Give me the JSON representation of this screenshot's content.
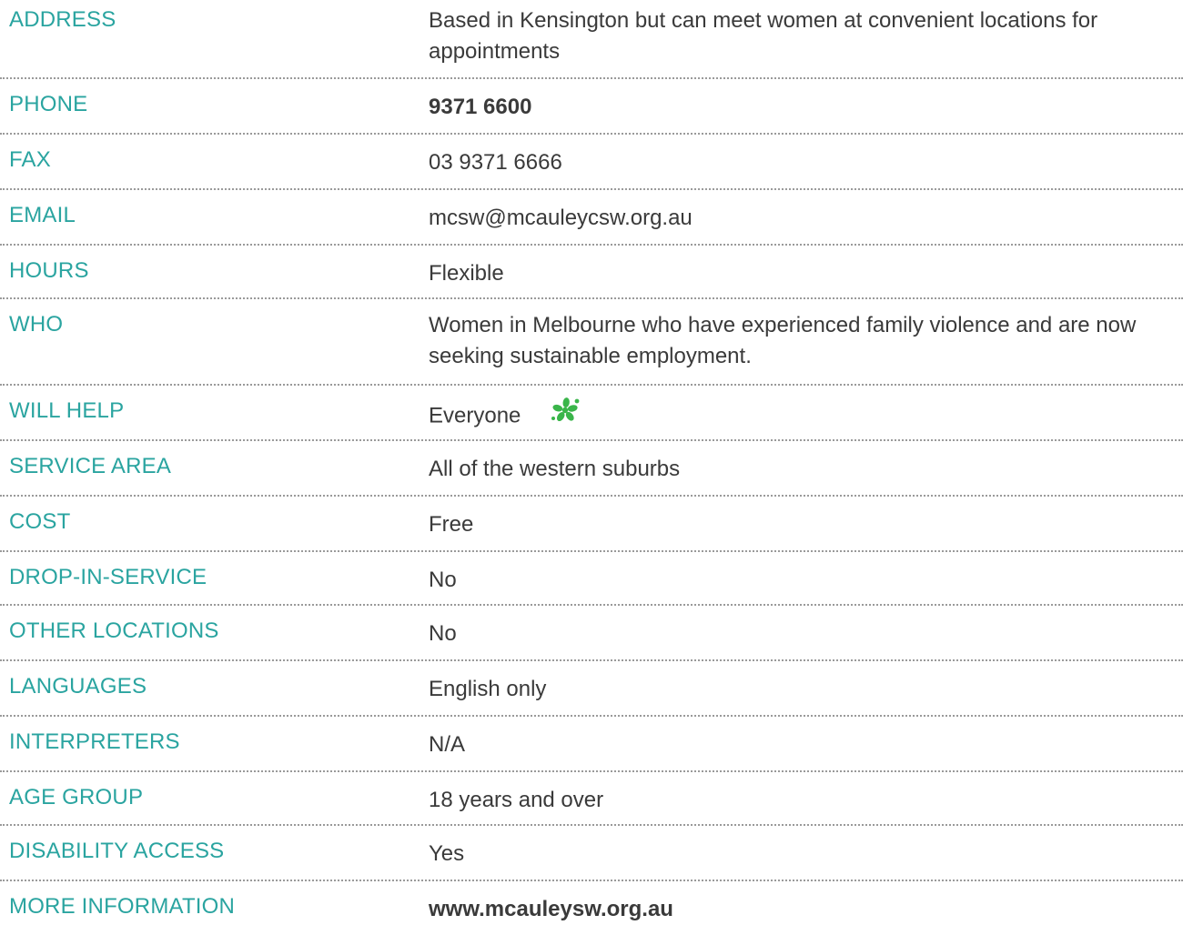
{
  "rows": [
    {
      "label": "ADDRESS",
      "value": "Based in Kensington but can meet women at convenient locations for appointments"
    },
    {
      "label": "PHONE",
      "value": "9371 6600"
    },
    {
      "label": "FAX",
      "value": "03 9371 6666"
    },
    {
      "label": "EMAIL",
      "value": "mcsw@mcauleycsw.org.au"
    },
    {
      "label": "HOURS",
      "value": "Flexible"
    },
    {
      "label": "WHO",
      "value": "Women in Melbourne who have experienced family violence and are now seeking sustainable employment."
    },
    {
      "label": "WILL HELP",
      "value": "Everyone",
      "icon": "green-asterisk-flower-icon"
    },
    {
      "label": "SERVICE AREA",
      "value": "All of the western suburbs"
    },
    {
      "label": "COST",
      "value": "Free"
    },
    {
      "label": "DROP-IN-SERVICE",
      "value": "No"
    },
    {
      "label": "OTHER LOCATIONS",
      "value": "No"
    },
    {
      "label": "LANGUAGES",
      "value": "English only"
    },
    {
      "label": "INTERPRETERS",
      "value": "N/A"
    },
    {
      "label": "AGE GROUP",
      "value": "18 years and over"
    },
    {
      "label": "DISABILITY ACCESS",
      "value": "Yes"
    },
    {
      "label": "MORE INFORMATION",
      "value": "www.mcauleysw.org.au"
    }
  ],
  "colors": {
    "label": "#2aa4a0",
    "text": "#3a3a3a",
    "divider": "#9a9a9a",
    "icon": "#3ab54a"
  }
}
